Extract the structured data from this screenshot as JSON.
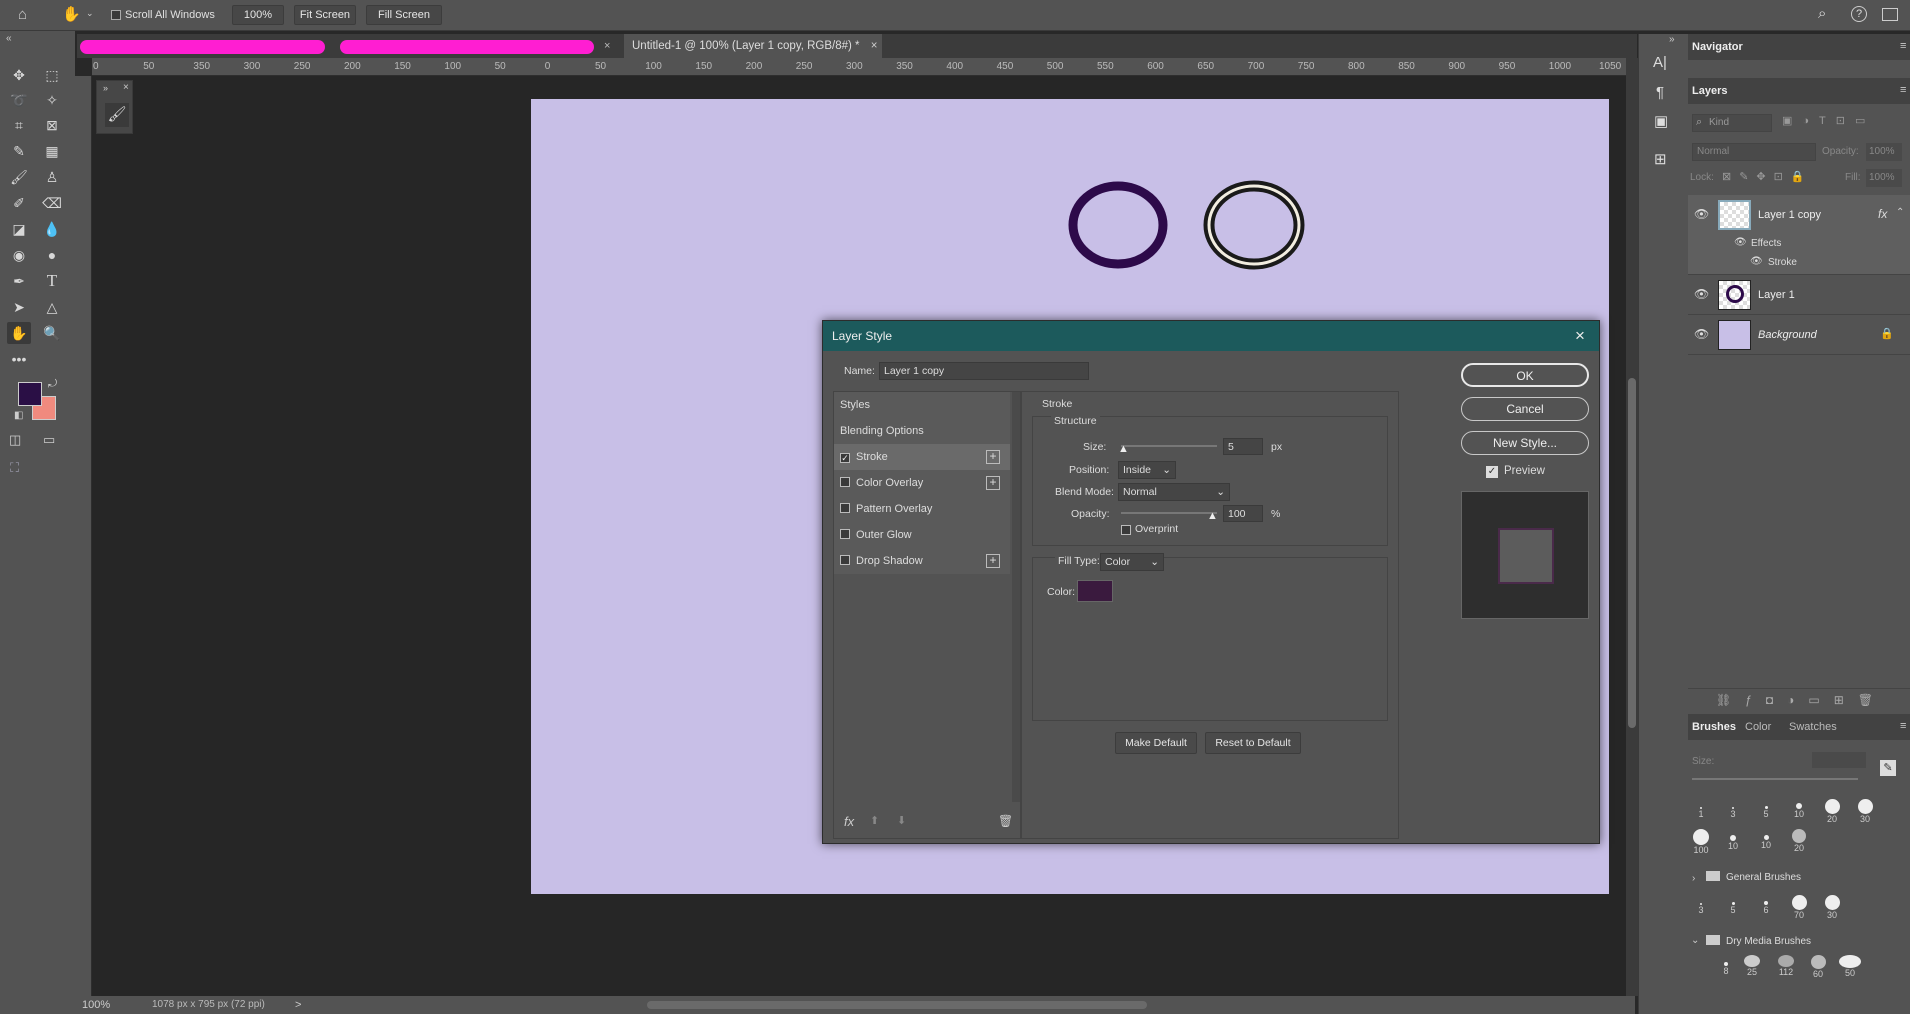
{
  "options_bar": {
    "scroll_all_windows": "Scroll All Windows",
    "zoom_value": "100%",
    "fit_screen": "Fit Screen",
    "fill_screen": "Fill Screen"
  },
  "document_tab": {
    "title": "Untitled-1 @ 100% (Layer 1 copy, RGB/8#) *",
    "close": "×"
  },
  "ruler_top_labels": [
    "0",
    "50",
    "350",
    "300",
    "250",
    "200",
    "150",
    "100",
    "50",
    "0",
    "50",
    "100",
    "150",
    "200",
    "250",
    "300",
    "350",
    "400",
    "450",
    "500",
    "550",
    "600",
    "650",
    "700",
    "750",
    "800",
    "850",
    "900",
    "950",
    "1000",
    "1050"
  ],
  "status": {
    "zoom": "100%",
    "doc_info": "1078 px x 795 px (72 ppi)",
    "arrow": ">"
  },
  "navigator_tab": "Navigator",
  "layers_panel": {
    "tab": "Layers",
    "kind_placeholder": "Kind",
    "blend_mode": "Normal",
    "opacity_label": "Opacity:",
    "opacity_value": "100%",
    "lock_label": "Lock:",
    "fill_label": "Fill:",
    "fill_value": "100%",
    "layers": [
      {
        "name": "Layer 1 copy",
        "fx": "fx",
        "effects_label": "Effects",
        "effect": "Stroke"
      },
      {
        "name": "Layer 1"
      },
      {
        "name": "Background"
      }
    ]
  },
  "brushes_panel": {
    "tabs": [
      "Brushes",
      "Color",
      "Swatches"
    ],
    "size_label": "Size:",
    "row1": [
      "1",
      "3",
      "5",
      "10",
      "20",
      "30"
    ],
    "row2": [
      "100",
      "10",
      "10",
      "20"
    ],
    "group1": "General Brushes",
    "row3": [
      "3",
      "5",
      "6",
      "70",
      "30"
    ],
    "group2": "Dry Media Brushes",
    "row4": [
      "8",
      "25",
      "112",
      "60",
      "50"
    ]
  },
  "dialog": {
    "title": "Layer Style",
    "name_label": "Name:",
    "name_value": "Layer 1 copy",
    "styles_header": "Styles",
    "blending_options": "Blending Options",
    "style_items": [
      {
        "label": "Stroke",
        "checked": true
      },
      {
        "label": "Color Overlay",
        "checked": false
      },
      {
        "label": "Pattern Overlay",
        "checked": false
      },
      {
        "label": "Outer Glow",
        "checked": false
      },
      {
        "label": "Drop Shadow",
        "checked": false
      }
    ],
    "fx_label": "fx",
    "section_title": "Stroke",
    "structure_label": "Structure",
    "size_label": "Size:",
    "size_value": "5",
    "size_unit": "px",
    "position_label": "Position:",
    "position_value": "Inside",
    "blend_label": "Blend Mode:",
    "blend_value": "Normal",
    "opacity_label": "Opacity:",
    "opacity_value": "100",
    "opacity_unit": "%",
    "overprint_label": "Overprint",
    "fill_type_label": "Fill Type:",
    "fill_type_value": "Color",
    "color_label": "Color:",
    "stroke_color": "#3a1a3e",
    "make_default": "Make Default",
    "reset_default": "Reset to Default",
    "ok": "OK",
    "cancel": "Cancel",
    "new_style": "New Style...",
    "preview_label": "Preview",
    "close": "×"
  },
  "colors": {
    "foreground": "#2a0f45",
    "background": "#f08a7e",
    "canvas": "#c8bfe7",
    "circle": "#2d0a4a",
    "accent_titlebar": "#1c5a5c"
  }
}
